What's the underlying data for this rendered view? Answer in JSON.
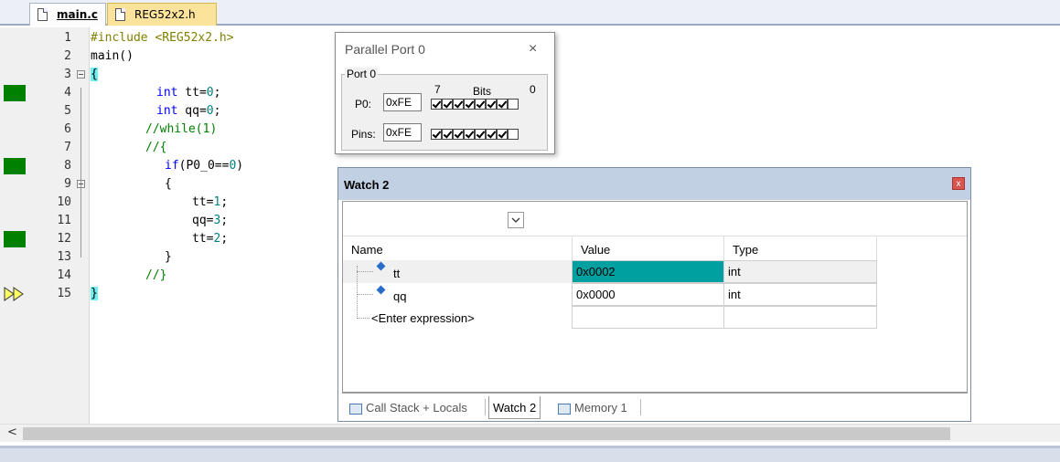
{
  "tabs": [
    {
      "label": "main.c"
    },
    {
      "label": "REG52x2.h"
    }
  ],
  "editor": {
    "lines": [
      {
        "num": "1"
      },
      {
        "num": "2"
      },
      {
        "num": "3"
      },
      {
        "num": "4"
      },
      {
        "num": "5"
      },
      {
        "num": "6"
      },
      {
        "num": "7"
      },
      {
        "num": "8"
      },
      {
        "num": "9"
      },
      {
        "num": "10"
      },
      {
        "num": "11"
      },
      {
        "num": "12"
      },
      {
        "num": "13"
      },
      {
        "num": "14"
      },
      {
        "num": "15"
      }
    ],
    "code": {
      "l1_pp": "#include <REG52x2.h>",
      "l2": "main()",
      "l3_brace": "{",
      "l4_kw": "int",
      "l4_rest": " tt=",
      "l4_num": "0",
      "l4_end": ";",
      "l5_kw": "int",
      "l5_rest": " qq=",
      "l5_num": "0",
      "l5_end": ";",
      "l6": "//while(1)",
      "l7": "//{",
      "l8_kw": "if",
      "l8_rest": "(P0_0==",
      "l8_num": "0",
      "l8_end": ")",
      "l9": "{",
      "l10_a": "tt=",
      "l10_num": "1",
      "l10_end": ";",
      "l11_a": "qq=",
      "l11_num": "3",
      "l11_end": ";",
      "l12_a": "tt=",
      "l12_num": "2",
      "l12_end": ";",
      "l13": "}",
      "l14": "//}",
      "l15_brace": "}"
    }
  },
  "scrollbar": {
    "left_arrow": "<"
  },
  "parallel_port": {
    "title": "Parallel Port 0",
    "close": "×",
    "group_label": "Port 0",
    "bits_hi": "7",
    "bits_label": "Bits",
    "bits_lo": "0",
    "p0_label": "P0:",
    "p0_value": "0xFE",
    "pins_label": "Pins:",
    "pins_value": "0xFE",
    "p0_bits": [
      true,
      true,
      true,
      true,
      true,
      true,
      true,
      false
    ],
    "pins_bits": [
      true,
      true,
      true,
      true,
      true,
      true,
      true,
      false
    ]
  },
  "watch": {
    "title": "Watch 2",
    "close": "x",
    "columns": {
      "name": "Name",
      "value": "Value",
      "type": "Type"
    },
    "rows": [
      {
        "name": "tt",
        "value": "0x0002",
        "type": "int",
        "highlight": "#00a0a0"
      },
      {
        "name": "qq",
        "value": "0x0000",
        "type": "int"
      },
      {
        "name": "<Enter expression>",
        "value": "",
        "type": ""
      }
    ],
    "tabs": [
      {
        "label": "Call Stack + Locals"
      },
      {
        "label": "Watch 2"
      },
      {
        "label": "Memory 1"
      }
    ]
  },
  "colors": {
    "breakpoint": "#008000",
    "highlight": "#00a0a0",
    "brace_highlight": "#6ef0f0"
  }
}
